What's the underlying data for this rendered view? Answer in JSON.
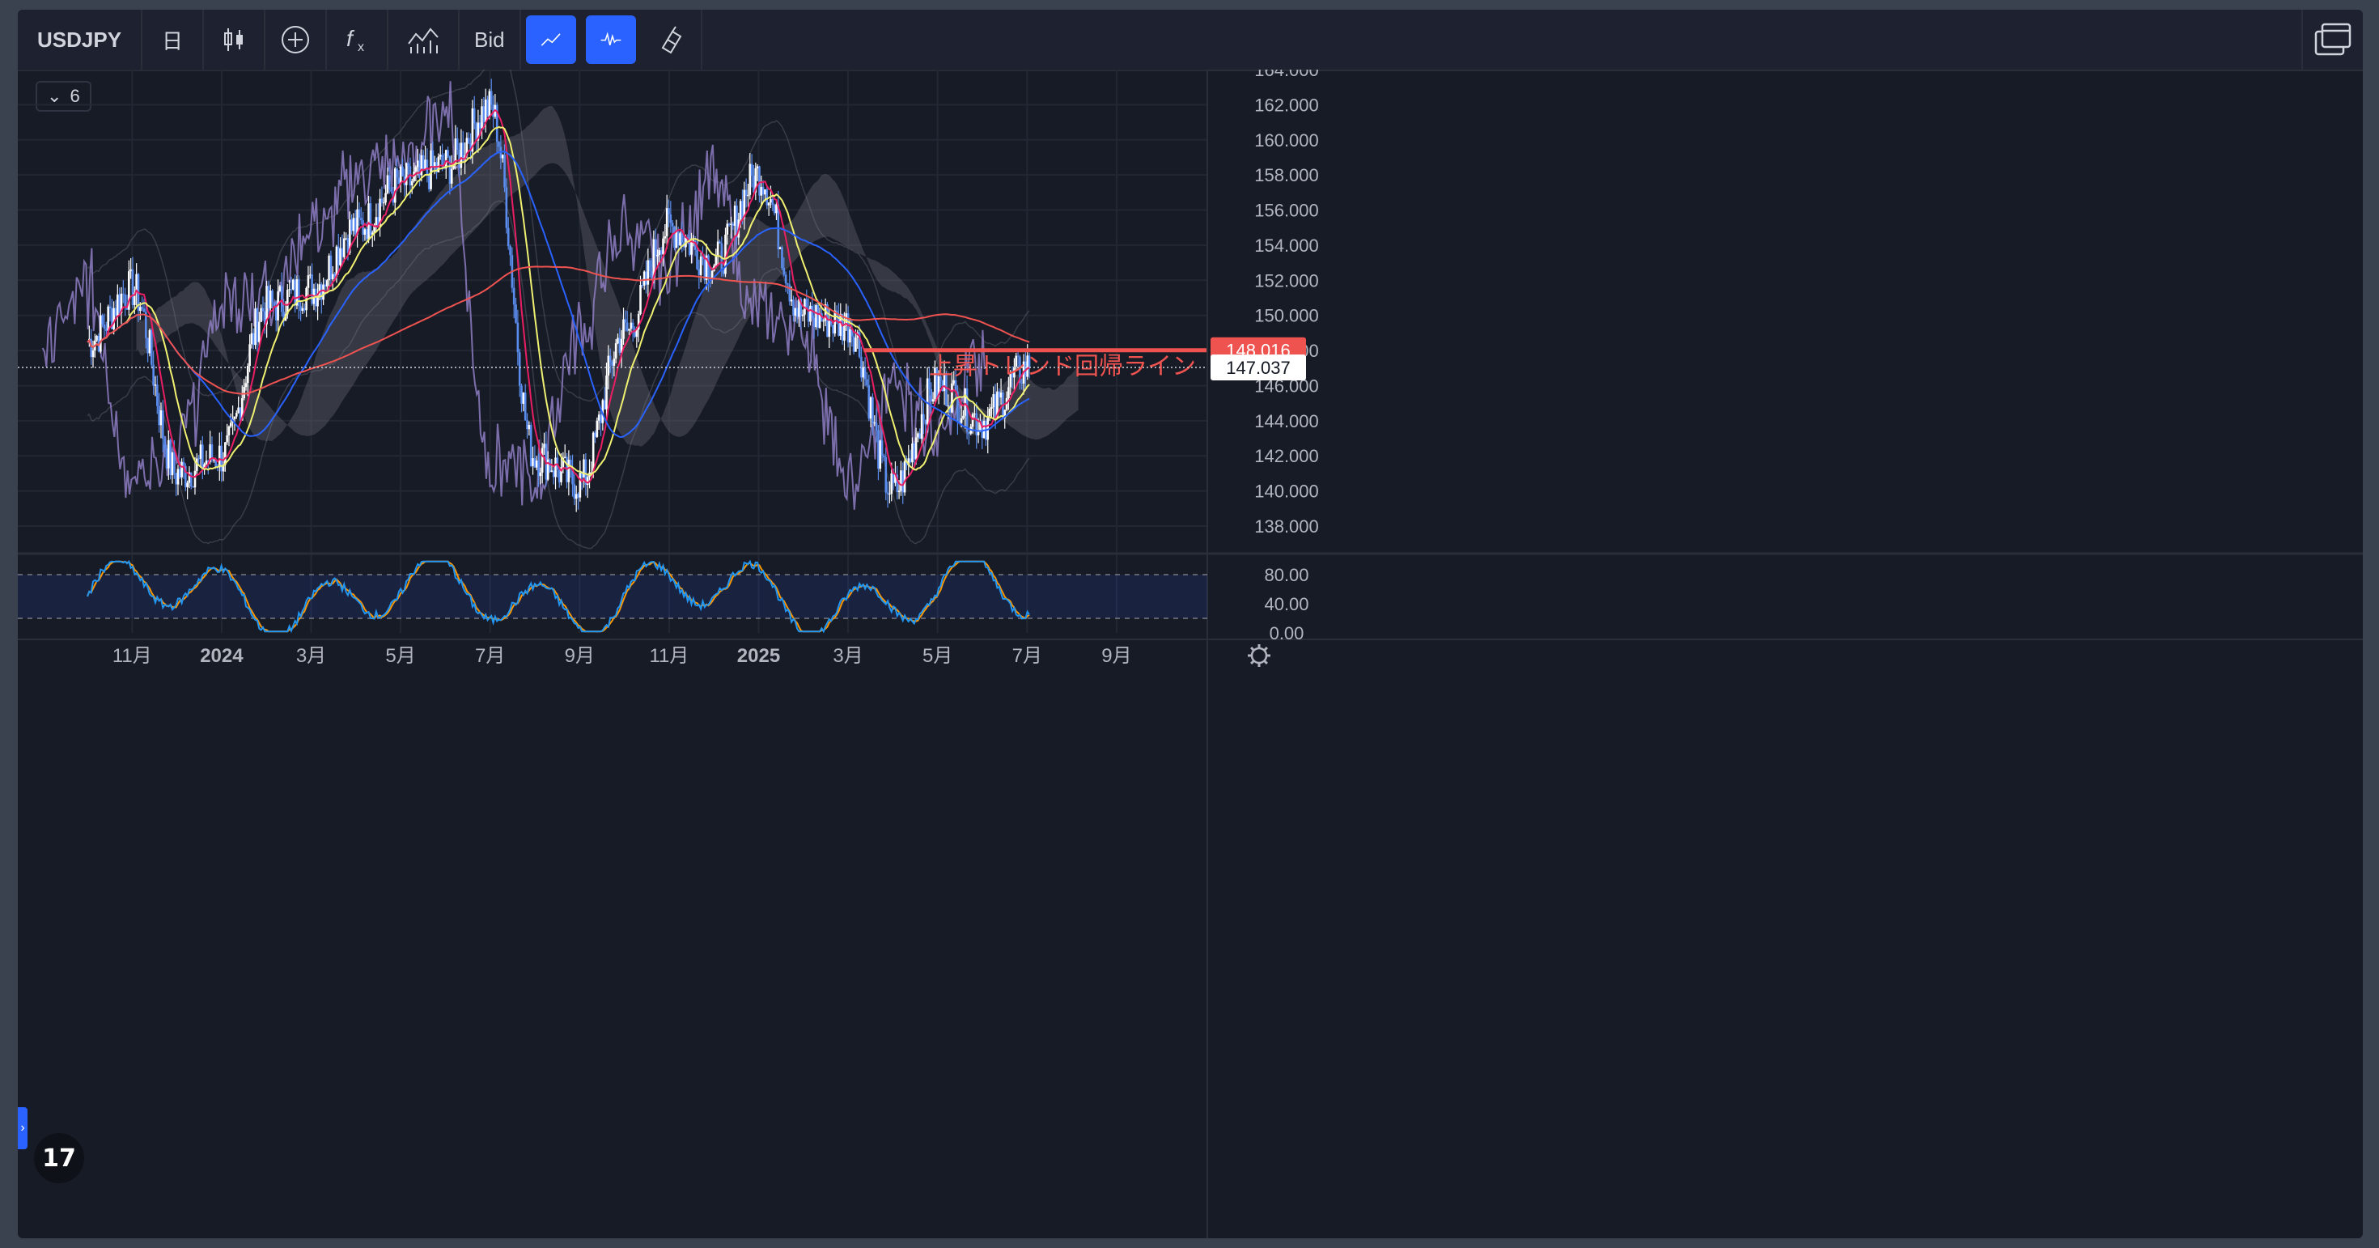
{
  "toolbar": {
    "symbol": "USDJPY",
    "interval": "日",
    "price_type": "Bid",
    "icons": [
      "candles-icon",
      "add-compare-icon",
      "indicators-icon",
      "templates-icon",
      "trend-line-icon",
      "pulse-icon",
      "brush-icon",
      "layout-icon"
    ]
  },
  "legend": {
    "count": "6"
  },
  "price_axis": {
    "ticks": [
      "164.000",
      "162.000",
      "160.000",
      "158.000",
      "156.000",
      "154.000",
      "152.000",
      "150.000",
      "148.000",
      "146.000",
      "144.000",
      "142.000",
      "140.000",
      "138.000"
    ],
    "current_price": "147.037",
    "line_price": "148.016"
  },
  "annotation": {
    "text": "上昇トレンド回帰ライン",
    "color": "#ef5350"
  },
  "oscillator_axis": {
    "ticks": [
      "80.00",
      "40.00",
      "0.00"
    ]
  },
  "time_axis": {
    "labels": [
      "11月",
      "2024",
      "3月",
      "5月",
      "7月",
      "9月",
      "11月",
      "2025",
      "3月",
      "5月",
      "7月",
      "9月"
    ]
  },
  "colors": {
    "background": "#171b26",
    "up": "#ffffff",
    "down": "#5b8def",
    "ma_short": "#e91e63",
    "ma_mid": "#f0f071",
    "ma_long": "#2962ff",
    "ma_200": "#ef5350",
    "chikou": "#8e7cc3",
    "stoch_k": "#2196f3",
    "stoch_d": "#ff9800",
    "accent": "#2962ff"
  },
  "chart_data": {
    "type": "candlestick",
    "symbol": "USDJPY",
    "ylim": [
      137,
      165.5
    ],
    "key_points": [
      {
        "x": "2023-10",
        "y": 148.5
      },
      {
        "x": "2023-11",
        "y": 151.5
      },
      {
        "x": "2023-12",
        "y": 141.0
      },
      {
        "x": "2024-01",
        "y": 142.0
      },
      {
        "x": "2024-02",
        "y": 150.5
      },
      {
        "x": "2024-03",
        "y": 151.5
      },
      {
        "x": "2024-04",
        "y": 155.0
      },
      {
        "x": "2024-05",
        "y": 157.5
      },
      {
        "x": "2024-06",
        "y": 158.5
      },
      {
        "x": "2024-07",
        "y": 161.8
      },
      {
        "x": "2024-08",
        "y": 142.0
      },
      {
        "x": "2024-09",
        "y": 140.5
      },
      {
        "x": "2024-10",
        "y": 149.0
      },
      {
        "x": "2024-11",
        "y": 155.0
      },
      {
        "x": "2024-12",
        "y": 153.0
      },
      {
        "x": "2025-01",
        "y": 158.0
      },
      {
        "x": "2025-02",
        "y": 150.0
      },
      {
        "x": "2025-03",
        "y": 149.5
      },
      {
        "x": "2025-04",
        "y": 140.0
      },
      {
        "x": "2025-05",
        "y": 146.0
      },
      {
        "x": "2025-06",
        "y": 144.0
      },
      {
        "x": "2025-07",
        "y": 147.0
      }
    ],
    "horizontal_line": 148.016,
    "last_price": 147.037
  }
}
